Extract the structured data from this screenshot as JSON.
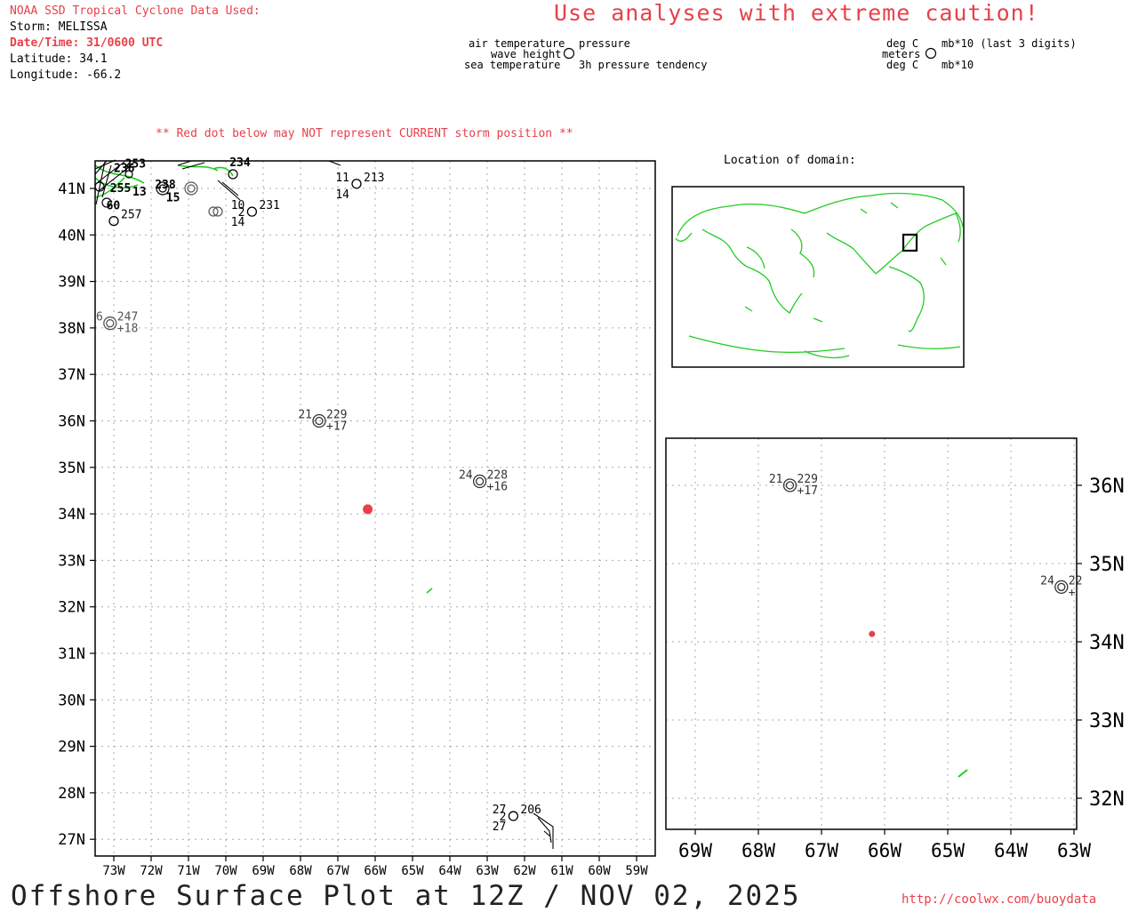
{
  "header": {
    "source": "NOAA SSD Tropical Cyclone Data Used:",
    "storm": "Storm: MELISSA",
    "datetime": "Date/Time: 31/0600 UTC",
    "latitude": "Latitude: 34.1",
    "longitude": "Longitude: -66.2",
    "caution": "Use analyses with extreme caution!"
  },
  "legend": {
    "air_temperature": "air temperature",
    "pressure": "pressure",
    "wave_height": "wave height",
    "sea_temperature": "sea temperature",
    "pressure_tendency": "3h pressure tendency",
    "units_air": "deg C",
    "units_pressure": "mb*10 (last 3 digits)",
    "units_wave": "meters",
    "units_sea": "deg C",
    "units_tendency": "mb*10"
  },
  "notice": "** Red dot below may NOT represent CURRENT storm position **",
  "inset": {
    "title": "Location of domain:"
  },
  "footer": {
    "title": "Offshore Surface Plot at 12Z / NOV 02, 2025",
    "url": "http://coolwx.com/buoydata"
  },
  "main_map": {
    "lat_labels": [
      "41N",
      "40N",
      "39N",
      "38N",
      "37N",
      "36N",
      "35N",
      "34N",
      "33N",
      "32N",
      "31N",
      "30N",
      "29N",
      "28N",
      "27N"
    ],
    "lon_labels": [
      "73W",
      "72W",
      "71W",
      "70W",
      "69W",
      "68W",
      "67W",
      "66W",
      "65W",
      "64W",
      "63W",
      "62W",
      "61W",
      "60W",
      "59W"
    ],
    "storm": {
      "lat": 34.1,
      "lon": -66.2
    },
    "stations": [
      {
        "lat": 38.1,
        "lon": -73.1,
        "air": "6",
        "pressure": "247",
        "tendency": "+18",
        "type": "double",
        "color": "#555"
      },
      {
        "lat": 36.0,
        "lon": -67.5,
        "air": "21",
        "pressure": "229",
        "tendency": "+17",
        "type": "double",
        "color": "#333"
      },
      {
        "lat": 34.7,
        "lon": -63.2,
        "air": "24",
        "pressure": "228",
        "tendency": "+16",
        "type": "double",
        "color": "#333"
      },
      {
        "lat": 41.1,
        "lon": -66.5,
        "air": "11",
        "pressure": "213",
        "sea": "14",
        "type": "single",
        "color": "#000"
      },
      {
        "lat": 40.5,
        "lon": -69.3,
        "air": "10",
        "pressure": "231",
        "wave": "2",
        "sea": "14",
        "type": "single",
        "color": "#000"
      },
      {
        "lat": 40.3,
        "lon": -73.0,
        "air": "",
        "pressure": "257",
        "type": "single",
        "color": "#000"
      },
      {
        "lat": 27.5,
        "lon": -62.3,
        "air": "27",
        "pressure": "206",
        "wave": "2",
        "sea": "27",
        "type": "single",
        "color": "#000"
      }
    ],
    "clutter_labels": [
      {
        "lat": 41.45,
        "lon": -72.7,
        "text": "253"
      },
      {
        "lat": 41.35,
        "lon": -73.0,
        "text": "236"
      },
      {
        "lat": 41.0,
        "lon": -71.9,
        "text": "238"
      },
      {
        "lat": 41.48,
        "lon": -69.9,
        "text": "234"
      },
      {
        "lat": 40.92,
        "lon": -73.1,
        "text": "255"
      },
      {
        "lat": 40.55,
        "lon": -73.2,
        "text": "60"
      },
      {
        "lat": 40.85,
        "lon": -72.5,
        "text": "13"
      },
      {
        "lat": 40.72,
        "lon": -71.6,
        "text": "15"
      }
    ]
  },
  "zoom_map": {
    "lat_labels": [
      "36N",
      "35N",
      "34N",
      "33N",
      "32N"
    ],
    "lon_labels": [
      "69W",
      "68W",
      "67W",
      "66W",
      "65W",
      "64W",
      "63W"
    ],
    "storm": {
      "lat": 34.1,
      "lon": -66.2
    },
    "stations": [
      {
        "lat": 36.0,
        "lon": -67.5,
        "air": "21",
        "pressure": "229",
        "tendency": "+17"
      },
      {
        "lat": 34.7,
        "lon": -63.2,
        "air": "24",
        "pressure": "22",
        "tendency": "+"
      }
    ]
  },
  "colors": {
    "coast": "#22cc22",
    "storm": "#e8404a",
    "grid": "#aaaaaa",
    "caution": "#e8404a"
  }
}
